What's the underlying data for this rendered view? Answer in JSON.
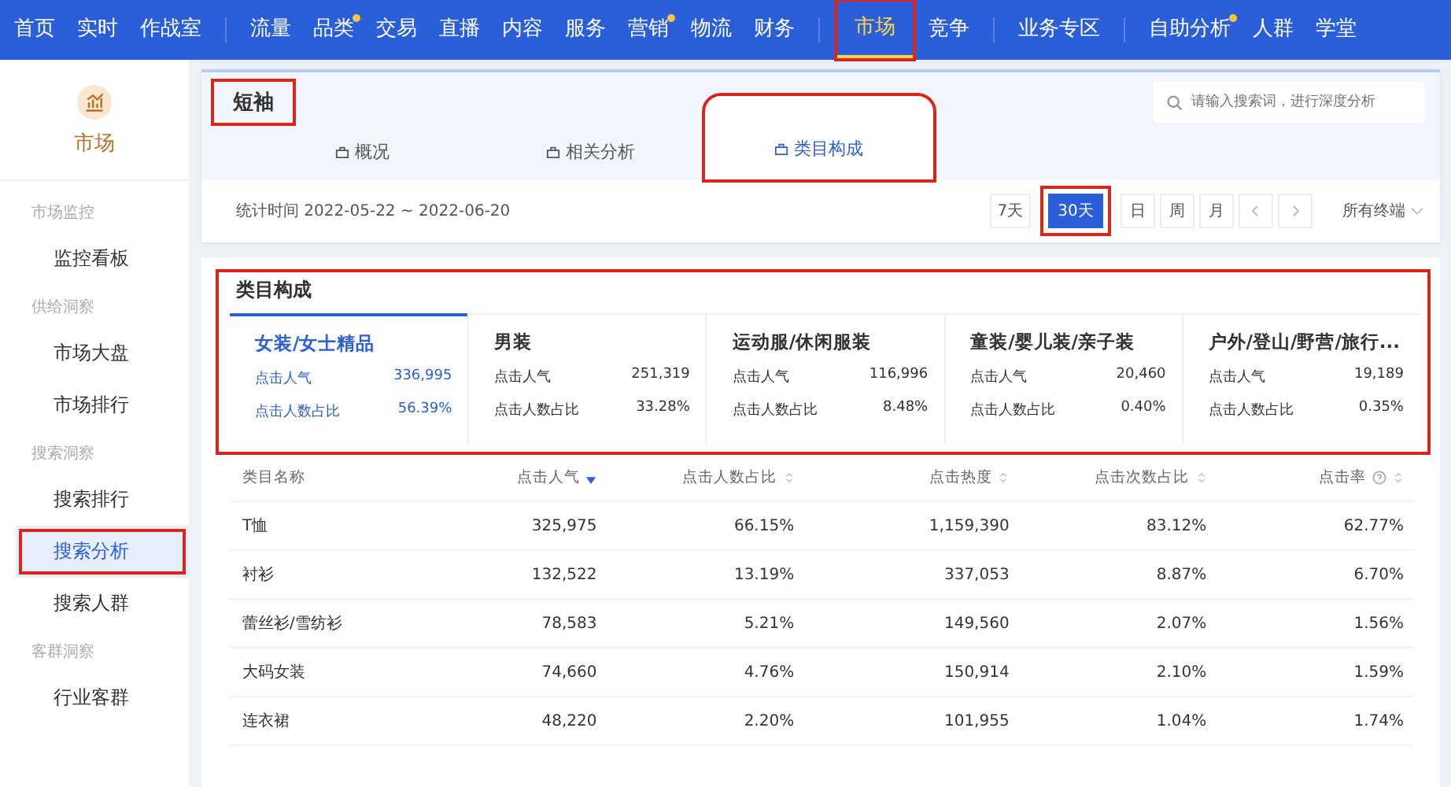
{
  "nav": {
    "groups": [
      [
        {
          "label": "首页",
          "selected": false,
          "dot": false
        },
        {
          "label": "实时",
          "selected": false,
          "dot": false
        },
        {
          "label": "作战室",
          "selected": false,
          "dot": false
        }
      ],
      [
        {
          "label": "流量",
          "selected": false,
          "dot": false
        },
        {
          "label": "品类",
          "selected": false,
          "dot": true
        },
        {
          "label": "交易",
          "selected": false,
          "dot": false
        },
        {
          "label": "直播",
          "selected": false,
          "dot": false
        },
        {
          "label": "内容",
          "selected": false,
          "dot": false
        },
        {
          "label": "服务",
          "selected": false,
          "dot": false
        },
        {
          "label": "营销",
          "selected": false,
          "dot": true
        },
        {
          "label": "物流",
          "selected": false,
          "dot": false
        },
        {
          "label": "财务",
          "selected": false,
          "dot": false
        }
      ],
      [
        {
          "label": "市场",
          "selected": true,
          "dot": false,
          "highlighted": true
        },
        {
          "label": "竞争",
          "selected": false,
          "dot": false
        }
      ],
      [
        {
          "label": "业务专区",
          "selected": false,
          "dot": false
        }
      ],
      [
        {
          "label": "自助分析",
          "selected": false,
          "dot": true
        },
        {
          "label": "人群",
          "selected": false,
          "dot": false
        },
        {
          "label": "学堂",
          "selected": false,
          "dot": false
        }
      ]
    ]
  },
  "sidebar": {
    "title": "市场",
    "sections": [
      {
        "label": "市场监控",
        "items": [
          {
            "label": "监控看板",
            "selected": false
          }
        ]
      },
      {
        "label": "供给洞察",
        "items": [
          {
            "label": "市场大盘",
            "selected": false
          },
          {
            "label": "市场排行",
            "selected": false
          }
        ]
      },
      {
        "label": "搜索洞察",
        "items": [
          {
            "label": "搜索排行",
            "selected": false
          },
          {
            "label": "搜索分析",
            "selected": true,
            "highlighted": true
          },
          {
            "label": "搜索人群",
            "selected": false
          }
        ]
      },
      {
        "label": "客群洞察",
        "items": [
          {
            "label": "行业客群",
            "selected": false
          }
        ]
      }
    ]
  },
  "header": {
    "title": "短袖",
    "title_highlighted": true,
    "search": {
      "placeholder": "请输入搜索词，进行深度分析"
    },
    "tabs": [
      {
        "label": "概况",
        "selected": false
      },
      {
        "label": "相关分析",
        "selected": false
      },
      {
        "label": "类目构成",
        "selected": true,
        "highlighted": true
      }
    ],
    "period": "统计时间 2022-05-22 ~ 2022-06-20",
    "ranges": [
      {
        "label": "7天",
        "selected": false
      },
      {
        "label": "30天",
        "selected": true,
        "highlighted": true
      },
      {
        "label": "日",
        "selected": false
      },
      {
        "label": "周",
        "selected": false
      },
      {
        "label": "月",
        "selected": false
      }
    ],
    "terminal": "所有终端"
  },
  "categories": {
    "title": "类目构成",
    "highlighted": true,
    "tiles": [
      {
        "name": "女装/女士精品",
        "selected": true,
        "metric_1": "点击人气",
        "value_1": "336,995",
        "metric_2": "点击人数占比",
        "value_2": "56.39%"
      },
      {
        "name": "男装",
        "selected": false,
        "metric_1": "点击人气",
        "value_1": "251,319",
        "metric_2": "点击人数占比",
        "value_2": "33.28%"
      },
      {
        "name": "运动服/休闲服装",
        "selected": false,
        "metric_1": "点击人气",
        "value_1": "116,996",
        "metric_2": "点击人数占比",
        "value_2": "8.48%"
      },
      {
        "name": "童装/婴儿装/亲子装",
        "selected": false,
        "metric_1": "点击人气",
        "value_1": "20,460",
        "metric_2": "点击人数占比",
        "value_2": "0.40%"
      },
      {
        "name": "户外/登山/野营/旅行...",
        "selected": false,
        "metric_1": "点击人气",
        "value_1": "19,189",
        "metric_2": "点击人数占比",
        "value_2": "0.35%"
      }
    ]
  },
  "table": {
    "columns": [
      {
        "label": "类目名称",
        "sortable": false
      },
      {
        "label": "点击人气",
        "sortable": true,
        "sorted": true
      },
      {
        "label": "点击人数占比",
        "sortable": true,
        "sorted": false
      },
      {
        "label": "点击热度",
        "sortable": true,
        "sorted": false
      },
      {
        "label": "点击次数占比",
        "sortable": true,
        "sorted": false
      },
      {
        "label": "点击率",
        "sortable": true,
        "sorted": false,
        "help": true
      }
    ],
    "rows": [
      [
        "T恤",
        "325,975",
        "66.15%",
        "1,159,390",
        "83.12%",
        "62.77%"
      ],
      [
        "衬衫",
        "132,522",
        "13.19%",
        "337,053",
        "8.87%",
        "6.70%"
      ],
      [
        "蕾丝衫/雪纺衫",
        "78,583",
        "5.21%",
        "149,560",
        "2.07%",
        "1.56%"
      ],
      [
        "大码女装",
        "74,660",
        "4.76%",
        "150,914",
        "2.10%",
        "1.59%"
      ],
      [
        "连衣裙",
        "48,220",
        "2.20%",
        "101,955",
        "1.04%",
        "1.74%"
      ]
    ]
  }
}
